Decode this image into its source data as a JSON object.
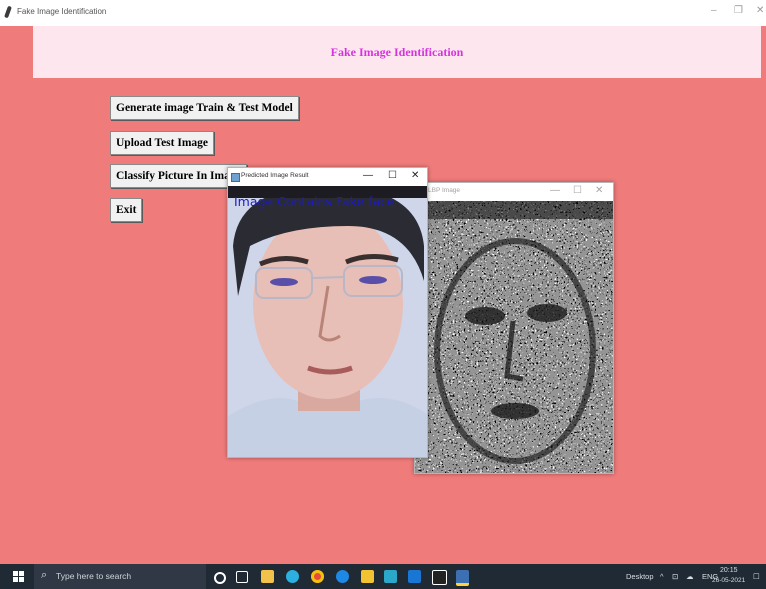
{
  "app_window": {
    "title": "Fake Image Identification",
    "controls": {
      "minimize": "–",
      "maximize": "❐",
      "close": "✕"
    }
  },
  "header": {
    "text": "Fake Image Identification"
  },
  "buttons": [
    {
      "label": "Generate image Train & Test Model"
    },
    {
      "label": "Upload Test Image"
    },
    {
      "label": "Classify Picture In Image"
    },
    {
      "label": "Exit"
    }
  ],
  "predicted_window": {
    "title": "Predicted Image Result",
    "overlay_text": "Image Contains Fake face",
    "controls": {
      "minimize": "—",
      "maximize": "☐",
      "close": "✕"
    }
  },
  "lbp_window": {
    "title": "LBP Image",
    "controls": {
      "minimize": "—",
      "maximize": "☐",
      "close": "✕"
    }
  },
  "taskbar": {
    "search_placeholder": "Type here to search",
    "desktop_label": "Desktop",
    "language": "ENG",
    "time": "20:15",
    "date": "26-05-2021",
    "icons": [
      "cortana-icon",
      "task-view-icon",
      "store-icon",
      "edge-icon",
      "chrome-icon",
      "mail-icon",
      "file-explorer-icon",
      "stack-icon",
      "outlook-icon",
      "terminal-icon",
      "python-icon"
    ]
  },
  "colors": {
    "background": "#f07b7b",
    "banner": "#fde6ee",
    "header_text": "#d633e0",
    "overlay_text": "#1a1acc",
    "taskbar": "#202a35"
  }
}
